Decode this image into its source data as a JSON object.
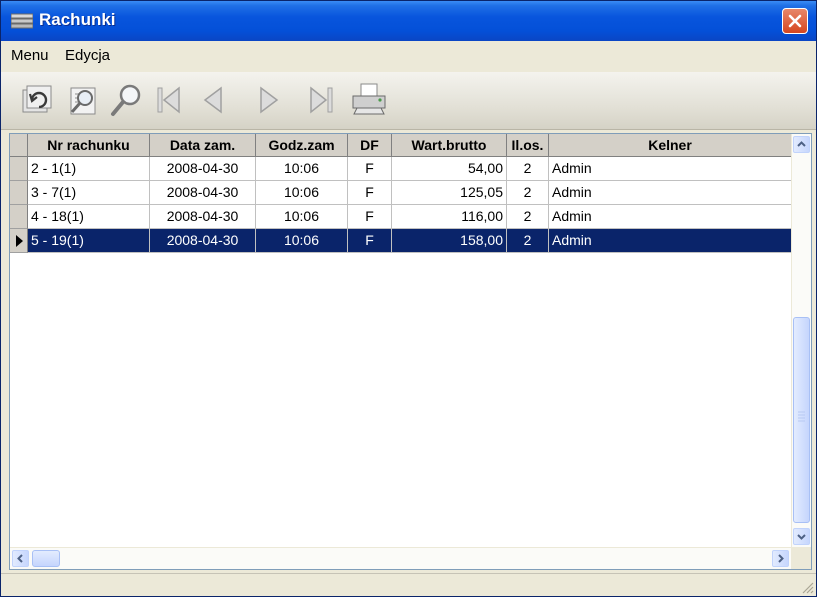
{
  "window": {
    "title": "Rachunki",
    "accent": "#0855dd",
    "title_icon": "table-icon"
  },
  "menu": {
    "items": [
      "Menu",
      "Edycja"
    ]
  },
  "toolbar": {
    "buttons": [
      "refresh-icon",
      "preview-icon",
      "search-icon",
      "first-record-icon",
      "previous-record-icon",
      "next-record-icon",
      "last-record-icon",
      "print-icon"
    ]
  },
  "grid": {
    "columns": [
      "Nr rachunku",
      "Data zam.",
      "Godz.zam",
      "DF",
      "Wart.brutto",
      "Il.os.",
      "Kelner"
    ],
    "rows": [
      [
        "2 - 1(1)",
        "2008-04-30",
        "10:06",
        "F",
        "54,00",
        "2",
        "Admin"
      ],
      [
        "3 - 7(1)",
        "2008-04-30",
        "10:06",
        "F",
        "125,05",
        "2",
        "Admin"
      ],
      [
        "4 - 18(1)",
        "2008-04-30",
        "10:06",
        "F",
        "116,00",
        "2",
        "Admin"
      ],
      [
        "5 - 19(1)",
        "2008-04-30",
        "10:06",
        "F",
        "158,00",
        "2",
        "Admin"
      ]
    ],
    "selected_row": 3,
    "selection_color": "#0a246a"
  }
}
